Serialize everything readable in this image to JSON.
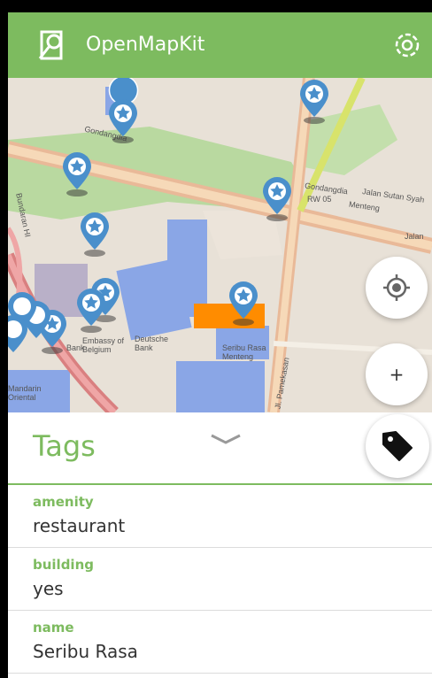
{
  "app": {
    "title": "OpenMapKit",
    "logo_icon": "openmapkit-logo-icon",
    "settings_icon": "gear-icon",
    "accent": "#7dbb5f"
  },
  "map": {
    "labels": {
      "gondangdia_1": "Gondangdia",
      "gondangdia_2": "Gondangdia",
      "jalan_sutan_syah": "Jalan Sutan Syah",
      "rw05": "RW 05",
      "menteng_1": "Menteng",
      "jalan": "Jalan",
      "bundaran": "Bundaran HI",
      "embassy": "Embassy of Belgium",
      "deutsche": "Deutsche Bank",
      "seribu_map": "Seribu Rasa Menteng",
      "pamekasan": "Jl. Pamekasan",
      "bank": "Bank",
      "mandarin": "Mandarin Oriental"
    },
    "marker_icon": "star-marker-icon",
    "locate_icon": "crosshair-icon",
    "zoom_in_label": "+",
    "highlight_color": "#ff8c00"
  },
  "tags": {
    "title": "Tags",
    "collapse_icon": "chevron-down-icon",
    "tag_fab_icon": "tag-icon",
    "items": [
      {
        "key": "amenity",
        "value": "restaurant"
      },
      {
        "key": "building",
        "value": "yes"
      },
      {
        "key": "name",
        "value": "Seribu Rasa"
      }
    ]
  }
}
